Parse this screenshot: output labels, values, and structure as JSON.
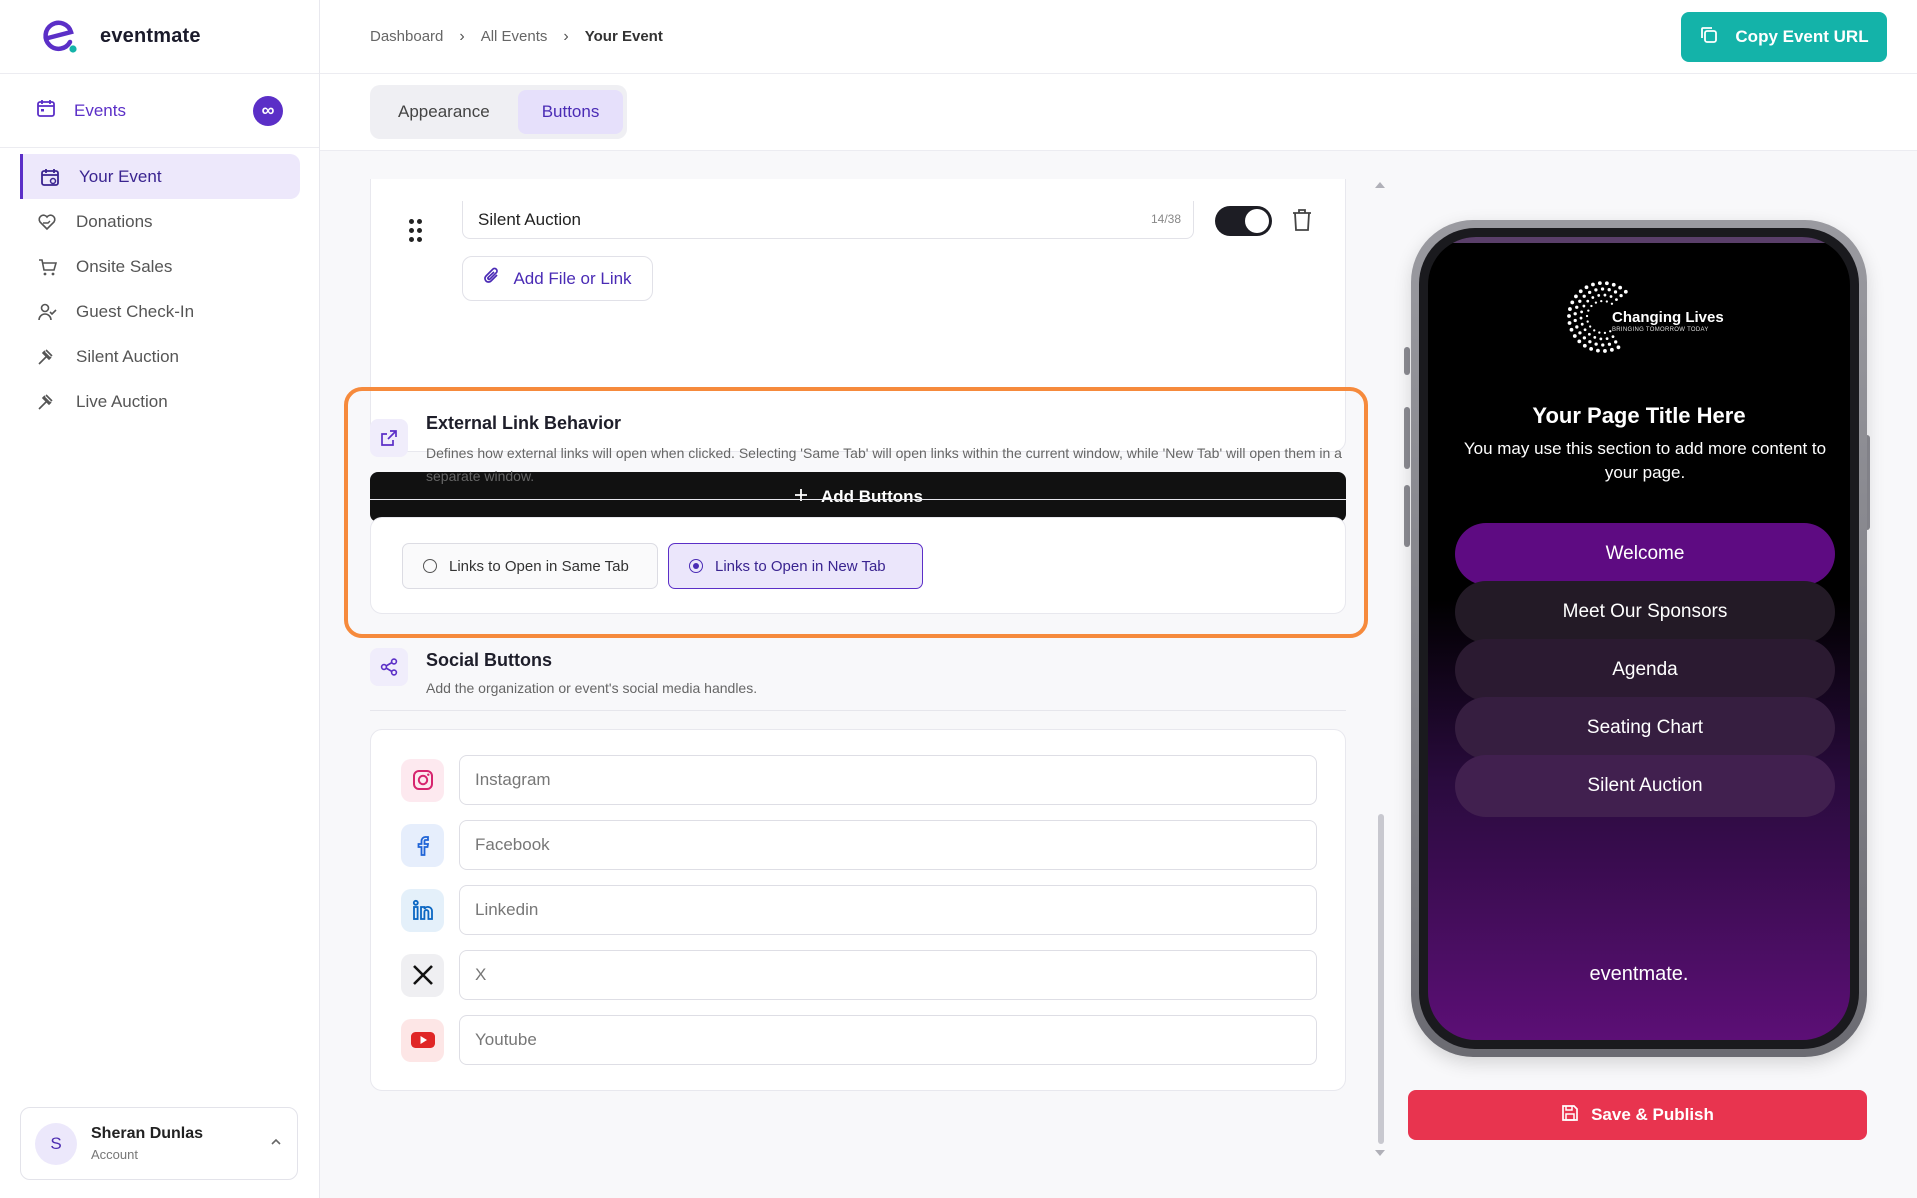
{
  "app": {
    "name": "eventmate"
  },
  "sidebar": {
    "events_label": "Events",
    "events_badge": "∞",
    "items": [
      {
        "label": "Your Event",
        "icon": "calendar-icon",
        "active": true
      },
      {
        "label": "Donations",
        "icon": "heart-hand-icon"
      },
      {
        "label": "Onsite Sales",
        "icon": "cart-icon"
      },
      {
        "label": "Guest Check-In",
        "icon": "user-check-icon"
      },
      {
        "label": "Silent Auction",
        "icon": "gavel-icon"
      },
      {
        "label": "Live Auction",
        "icon": "gavel-icon"
      }
    ],
    "user": {
      "initial": "S",
      "name": "Sheran Dunlas",
      "sub": "Account"
    }
  },
  "breadcrumb": {
    "items": [
      "Dashboard",
      "All Events",
      "Your Event"
    ]
  },
  "header": {
    "copy_url_label": "Copy Event URL"
  },
  "tabs": {
    "items": [
      {
        "label": "Appearance"
      },
      {
        "label": "Buttons",
        "active": true
      }
    ]
  },
  "button_item": {
    "title_value": "Silent Auction",
    "counter": "14/38",
    "enabled": true,
    "add_file_label": "Add File or Link"
  },
  "add_buttons_label": "Add Buttons",
  "link_behavior": {
    "title": "External Link Behavior",
    "description": "Defines how external links will open when clicked. Selecting 'Same Tab' will open links within the current window, while 'New Tab' will open them in a separate window.",
    "options": [
      {
        "label": "Links to Open in Same Tab",
        "selected": false
      },
      {
        "label": "Links to Open in New Tab",
        "selected": true
      }
    ]
  },
  "social": {
    "title": "Social Buttons",
    "description": "Add the organization or event's social media handles.",
    "fields": [
      {
        "placeholder": "Instagram",
        "icon": "instagram-icon"
      },
      {
        "placeholder": "Facebook",
        "icon": "facebook-icon"
      },
      {
        "placeholder": "Linkedin",
        "icon": "linkedin-icon"
      },
      {
        "placeholder": "X",
        "icon": "x-icon"
      },
      {
        "placeholder": "Youtube",
        "icon": "youtube-icon"
      }
    ]
  },
  "preview": {
    "brand_name": "Changing Lives",
    "brand_tagline": "BRINGING TOMORROW TODAY",
    "page_title": "Your Page Title Here",
    "page_description": "You may use this section to add more content to your page.",
    "buttons": [
      "Welcome",
      "Meet Our Sponsors",
      "Agenda",
      "Seating Chart",
      "Silent Auction"
    ],
    "footer": "eventmate."
  },
  "save_publish_label": "Save & Publish",
  "colors": {
    "accent": "#5b2fc7",
    "teal": "#14b3a9",
    "save": "#e8344f",
    "highlight": "#f68a3c"
  }
}
